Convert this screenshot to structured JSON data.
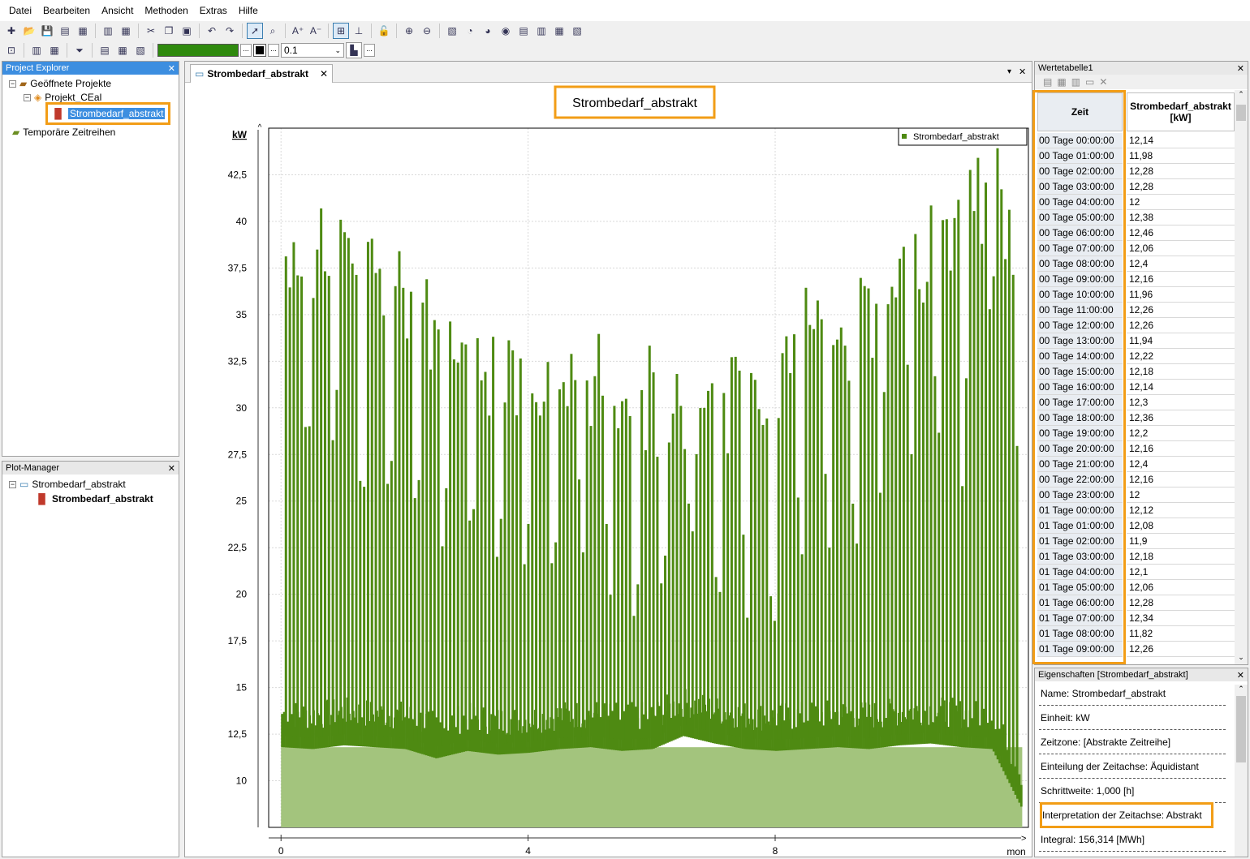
{
  "menu": [
    "Datei",
    "Bearbeiten",
    "Ansicht",
    "Methoden",
    "Extras",
    "Hilfe"
  ],
  "toolbar2": {
    "line_width_value": "0.1"
  },
  "project_explorer": {
    "title": "Project Explorer",
    "root": "Geöffnete Projekte",
    "project": "Projekt_CEal",
    "series": "Strombedarf_abstrakt",
    "temp": "Temporäre Zeitreihen"
  },
  "plot_manager": {
    "title": "Plot-Manager",
    "plot": "Strombedarf_abstrakt",
    "series": "Strombedarf_abstrakt"
  },
  "document_tab": {
    "label": "Strombedarf_abstrakt"
  },
  "chart_data": {
    "type": "area",
    "title": "Strombedarf_abstrakt",
    "ylabel": "kW",
    "xlabel": "mon",
    "ylim": [
      7.5,
      45
    ],
    "xlim": [
      -0.2,
      12.1
    ],
    "yticks": [
      "10",
      "12,5",
      "15",
      "17,5",
      "20",
      "22,5",
      "25",
      "27,5",
      "30",
      "32,5",
      "35",
      "37,5",
      "40",
      "42,5"
    ],
    "xticks": [
      "0",
      "4",
      "8"
    ],
    "legend": "top-right",
    "grid": true,
    "series": [
      {
        "name": "Strombedarf_abstrakt",
        "x_unit": "mon",
        "x": [
          0.0,
          0.5,
          1.0,
          1.5,
          2.0,
          2.5,
          3.0,
          3.5,
          4.0,
          4.5,
          5.0,
          5.5,
          6.0,
          6.5,
          7.0,
          7.5,
          8.0,
          8.5,
          9.0,
          9.5,
          10.0,
          10.5,
          11.0,
          11.5,
          12.0
        ],
        "base_values": [
          12.4,
          12.3,
          12.5,
          12.4,
          12.3,
          11.8,
          12.2,
          12.0,
          12.1,
          12.3,
          12.4,
          12.2,
          12.3,
          13.0,
          12.6,
          12.3,
          12.2,
          12.3,
          12.4,
          12.3,
          12.5,
          12.6,
          12.4,
          12.3,
          9.0
        ],
        "peak_values": [
          39.5,
          40.0,
          41.0,
          39.0,
          37.5,
          34.5,
          35.0,
          33.0,
          33.0,
          31.5,
          33.0,
          32.5,
          32.0,
          30.5,
          31.5,
          31.5,
          33.0,
          35.5,
          34.0,
          36.0,
          38.5,
          40.0,
          42.0,
          44.0,
          38.0
        ],
        "color": "#4e8a12",
        "fill_color": "#a3c47d"
      }
    ]
  },
  "value_table": {
    "title": "Wertetabelle1",
    "col_time": "Zeit",
    "col_value": "Strombedarf_abstrakt [kW]",
    "rows": [
      [
        "00 Tage 00:00:00",
        "12,14"
      ],
      [
        "00 Tage 01:00:00",
        "11,98"
      ],
      [
        "00 Tage 02:00:00",
        "12,28"
      ],
      [
        "00 Tage 03:00:00",
        "12,28"
      ],
      [
        "00 Tage 04:00:00",
        "12"
      ],
      [
        "00 Tage 05:00:00",
        "12,38"
      ],
      [
        "00 Tage 06:00:00",
        "12,46"
      ],
      [
        "00 Tage 07:00:00",
        "12,06"
      ],
      [
        "00 Tage 08:00:00",
        "12,4"
      ],
      [
        "00 Tage 09:00:00",
        "12,16"
      ],
      [
        "00 Tage 10:00:00",
        "11,96"
      ],
      [
        "00 Tage 11:00:00",
        "12,26"
      ],
      [
        "00 Tage 12:00:00",
        "12,26"
      ],
      [
        "00 Tage 13:00:00",
        "11,94"
      ],
      [
        "00 Tage 14:00:00",
        "12,22"
      ],
      [
        "00 Tage 15:00:00",
        "12,18"
      ],
      [
        "00 Tage 16:00:00",
        "12,14"
      ],
      [
        "00 Tage 17:00:00",
        "12,3"
      ],
      [
        "00 Tage 18:00:00",
        "12,36"
      ],
      [
        "00 Tage 19:00:00",
        "12,2"
      ],
      [
        "00 Tage 20:00:00",
        "12,16"
      ],
      [
        "00 Tage 21:00:00",
        "12,4"
      ],
      [
        "00 Tage 22:00:00",
        "12,16"
      ],
      [
        "00 Tage 23:00:00",
        "12"
      ],
      [
        "01 Tage 00:00:00",
        "12,12"
      ],
      [
        "01 Tage 01:00:00",
        "12,08"
      ],
      [
        "01 Tage 02:00:00",
        "11,9"
      ],
      [
        "01 Tage 03:00:00",
        "12,18"
      ],
      [
        "01 Tage 04:00:00",
        "12,1"
      ],
      [
        "01 Tage 05:00:00",
        "12,06"
      ],
      [
        "01 Tage 06:00:00",
        "12,28"
      ],
      [
        "01 Tage 07:00:00",
        "12,34"
      ],
      [
        "01 Tage 08:00:00",
        "11,82"
      ],
      [
        "01 Tage 09:00:00",
        "12,26"
      ]
    ]
  },
  "properties": {
    "title": "Eigenschaften [Strombedarf_abstrakt]",
    "items": [
      "Name: Strombedarf_abstrakt",
      "Einheit: kW",
      "Zeitzone: [Abstrakte Zeitreihe]",
      "Einteilung der Zeitachse: Äquidistant",
      "Schrittweite: 1,000 [h]",
      "Interpretation der Zeitachse: Abstrakt",
      "Integral: 156,314 [MWh]"
    ]
  }
}
